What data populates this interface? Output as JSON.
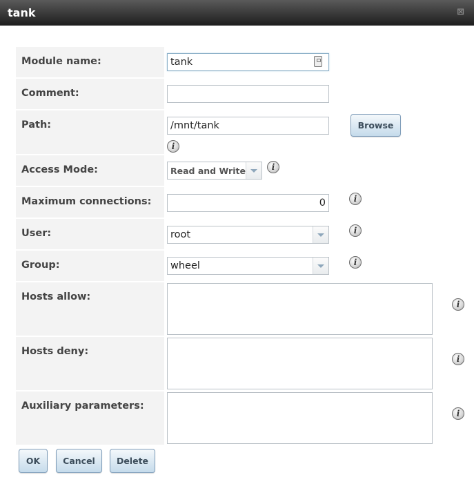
{
  "dialog": {
    "title": "tank",
    "close_glyph": "⊠"
  },
  "form": {
    "module_name": {
      "label": "Module name:",
      "value": "tank"
    },
    "comment": {
      "label": "Comment:",
      "value": ""
    },
    "path": {
      "label": "Path:",
      "value": "/mnt/tank",
      "browse_label": "Browse"
    },
    "access_mode": {
      "label": "Access Mode:",
      "value": "Read and Write"
    },
    "max_connections": {
      "label": "Maximum connections:",
      "value": "0"
    },
    "user": {
      "label": "User:",
      "value": "root"
    },
    "group": {
      "label": "Group:",
      "value": "wheel"
    },
    "hosts_allow": {
      "label": "Hosts allow:",
      "value": ""
    },
    "hosts_deny": {
      "label": "Hosts deny:",
      "value": ""
    },
    "auxiliary": {
      "label": "Auxiliary parameters:",
      "value": ""
    }
  },
  "icons": {
    "info": "info-icon",
    "info_glyph": "i"
  },
  "buttons": {
    "ok": "OK",
    "cancel": "Cancel",
    "delete": "Delete"
  }
}
